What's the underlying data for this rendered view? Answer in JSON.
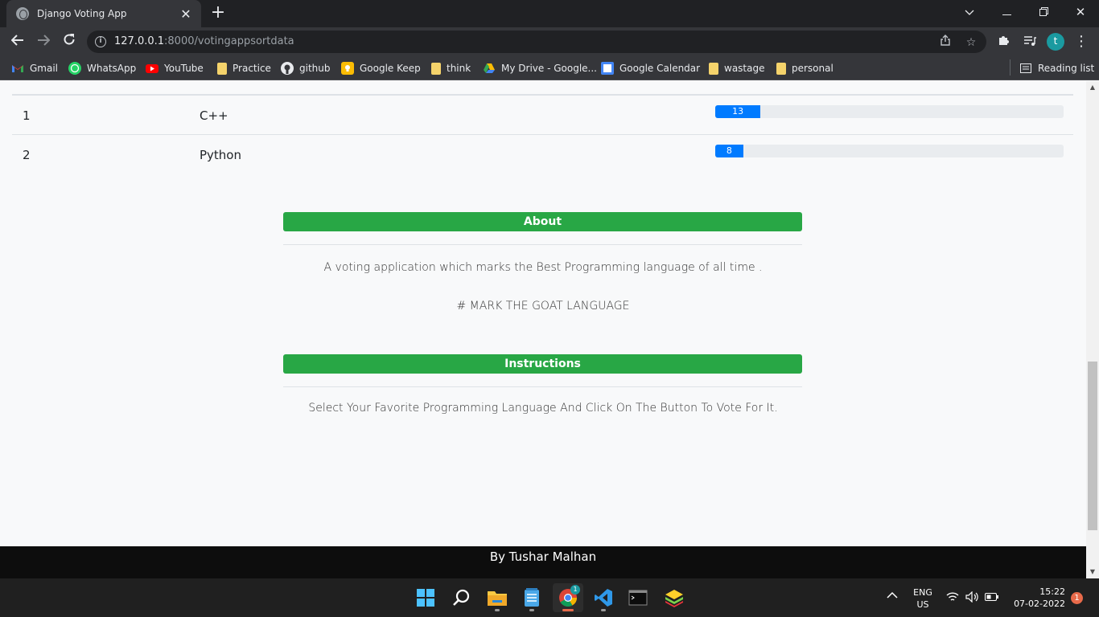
{
  "browser": {
    "tab_title": "Django Voting App",
    "new_tab_symbol": "+",
    "url_host": "127.0.0.1",
    "url_rest": ":8000/votingappsortdata",
    "profile_initial": "t",
    "bookmarks": [
      {
        "label": "Gmail",
        "icon": "gmail-icon"
      },
      {
        "label": "WhatsApp",
        "icon": "whatsapp-icon"
      },
      {
        "label": "YouTube",
        "icon": "youtube-icon"
      },
      {
        "label": "Practice",
        "icon": "folder-icon"
      },
      {
        "label": "github",
        "icon": "github-icon"
      },
      {
        "label": "Google Keep",
        "icon": "keep-icon"
      },
      {
        "label": "think",
        "icon": "folder-icon"
      },
      {
        "label": "My Drive - Google...",
        "icon": "drive-icon"
      },
      {
        "label": "Google Calendar",
        "icon": "calendar-icon"
      },
      {
        "label": "wastage",
        "icon": "folder-icon"
      },
      {
        "label": "personal",
        "icon": "folder-icon"
      }
    ],
    "reading_list": "Reading list"
  },
  "results": {
    "rows": [
      {
        "rank": "1",
        "language": "C++",
        "votes": "13",
        "progress": 0.13
      },
      {
        "rank": "2",
        "language": "Python",
        "votes": "8",
        "progress": 0.08
      }
    ]
  },
  "about": {
    "heading": "About",
    "text": "A voting application which marks the Best Programming language of all time .",
    "tagline": "# MARK THE GOAT LANGUAGE"
  },
  "instructions": {
    "heading": "Instructions",
    "text": "Select Your Favorite Programming Language And Click On The Button To Vote For It."
  },
  "footer": {
    "text": "By Tushar Malhan"
  },
  "taskbar": {
    "chrome_badge": "1",
    "lang_line1": "ENG",
    "lang_line2": "US",
    "time": "15:22",
    "date": "07-02-2022",
    "notification_count": "1"
  },
  "colors": {
    "progress": "#007bff",
    "section_header": "#28a745",
    "footer_bg": "#0d0d0d"
  }
}
